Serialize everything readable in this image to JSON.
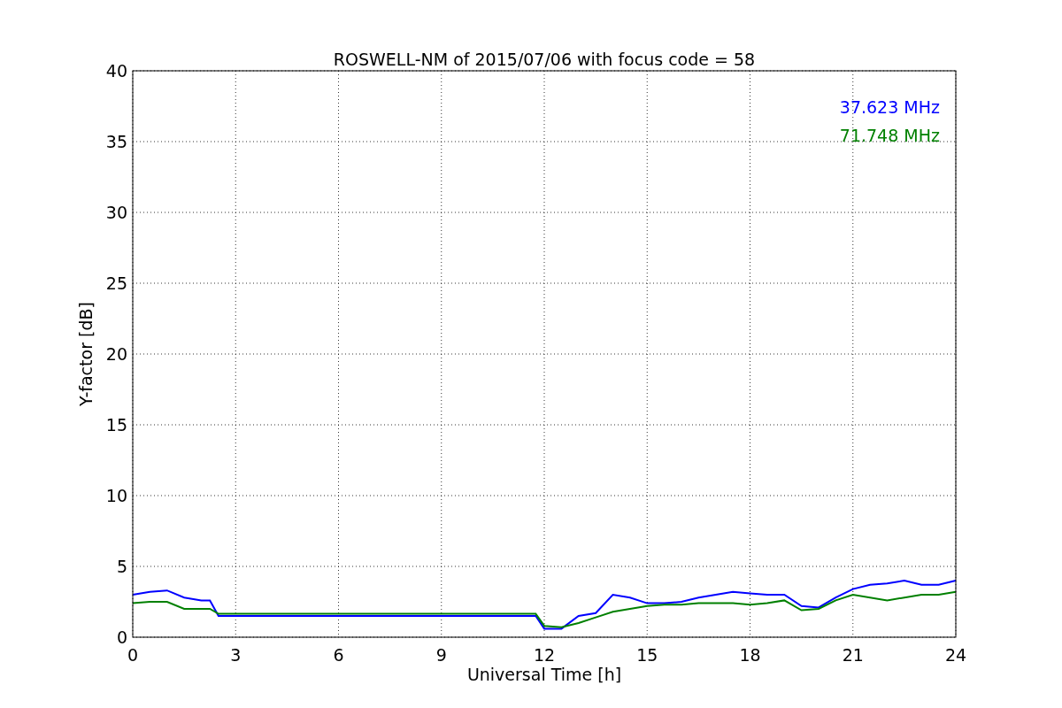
{
  "figure": {
    "chart_data": {
      "type": "line",
      "title": "ROSWELL-NM of 2015/07/06 with focus code = 58",
      "xlabel": "Universal Time [h]",
      "ylabel": "Y-factor [dB]",
      "x": [
        0,
        0.5,
        1,
        1.5,
        2,
        2.25,
        2.5,
        3,
        4,
        5,
        6,
        7,
        8,
        9,
        10,
        11,
        11.75,
        12,
        12.5,
        13,
        13.5,
        14,
        14.5,
        15,
        15.5,
        16,
        16.5,
        17,
        17.5,
        18,
        18.5,
        19,
        19.5,
        20,
        20.5,
        21,
        21.5,
        22,
        22.5,
        23,
        23.5,
        24
      ],
      "series": [
        {
          "name": "37.623 MHz",
          "color": "#0000ff",
          "values": [
            3.0,
            3.2,
            3.3,
            2.8,
            2.6,
            2.6,
            1.5,
            1.5,
            1.5,
            1.5,
            1.5,
            1.5,
            1.5,
            1.5,
            1.5,
            1.5,
            1.5,
            0.6,
            0.6,
            1.5,
            1.7,
            3.0,
            2.8,
            2.4,
            2.4,
            2.5,
            2.8,
            3.0,
            3.2,
            3.1,
            3.0,
            3.0,
            2.2,
            2.1,
            2.8,
            3.4,
            3.7,
            3.8,
            4.0,
            3.7,
            3.7,
            4.0
          ]
        },
        {
          "name": "71.748 MHz",
          "color": "#008000",
          "values": [
            2.4,
            2.5,
            2.5,
            2.0,
            2.0,
            2.0,
            1.65,
            1.65,
            1.65,
            1.65,
            1.65,
            1.65,
            1.65,
            1.65,
            1.65,
            1.65,
            1.65,
            0.8,
            0.7,
            1.0,
            1.4,
            1.8,
            2.0,
            2.2,
            2.3,
            2.3,
            2.4,
            2.4,
            2.4,
            2.3,
            2.4,
            2.6,
            1.9,
            2.0,
            2.6,
            3.0,
            2.8,
            2.6,
            2.8,
            3.0,
            3.0,
            3.2
          ]
        }
      ],
      "xlim": [
        0,
        24
      ],
      "ylim": [
        0,
        40
      ],
      "xticks": [
        0,
        3,
        6,
        9,
        12,
        15,
        18,
        21,
        24
      ],
      "yticks": [
        0,
        5,
        10,
        15,
        20,
        25,
        30,
        35,
        40
      ],
      "grid": true
    }
  }
}
